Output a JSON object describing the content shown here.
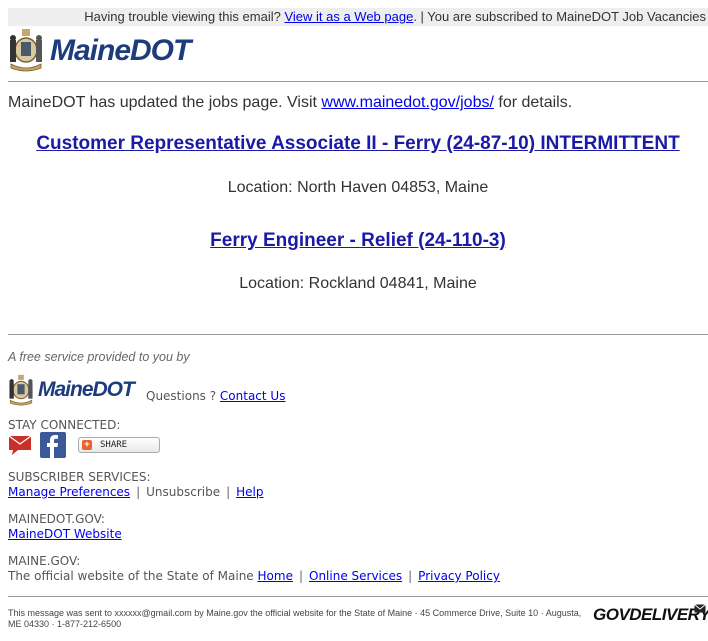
{
  "topbar": {
    "prefix": "Having trouble viewing this email? ",
    "view_link": "View it as a Web page",
    "suffix": ". | You are subscribed to MaineDOT Job Vacancies"
  },
  "header": {
    "logo_text": "MaineDOT"
  },
  "intro": {
    "prefix": "MaineDOT has updated the jobs page. Visit ",
    "link": "www.mainedot.gov/jobs/",
    "suffix": " for details."
  },
  "jobs": [
    {
      "title": "Customer Representative Associate II - Ferry (24-87-10) INTERMITTENT",
      "location": "Location: North Haven 04853, Maine"
    },
    {
      "title": "Ferry Engineer - Relief (24-110-3)",
      "location": "Location: Rockland 04841, Maine"
    }
  ],
  "footer": {
    "free_service": "A free service provided to you by",
    "logo_text": "MaineDOT",
    "questions": "Questions ? ",
    "contact_link": "Contact Us",
    "stay_connected": "STAY CONNECTED:",
    "share_label": "SHARE",
    "subscriber_services": "SUBSCRIBER SERVICES:",
    "manage_preferences": "Manage Preferences",
    "unsubscribe": "Unsubscribe",
    "help": "Help",
    "mainedot_gov_label": "MAINEDOT.GOV:",
    "mainedot_website": "MaineDOT Website",
    "maine_gov_label": "MAINE.GOV:",
    "maine_gov_text": "The official website of the State of Maine ",
    "home": "Home",
    "online_services": "Online Services",
    "privacy_policy": "Privacy Policy",
    "separator": "|",
    "legal": "This message was sent to xxxxxx@gmail.com by Maine.gov the official website for the State of Maine · 45 Commerce Drive, Suite 10 · Augusta, ME 04330 · 1-877-212-6500",
    "govdelivery": "GOVDELIVERY"
  }
}
